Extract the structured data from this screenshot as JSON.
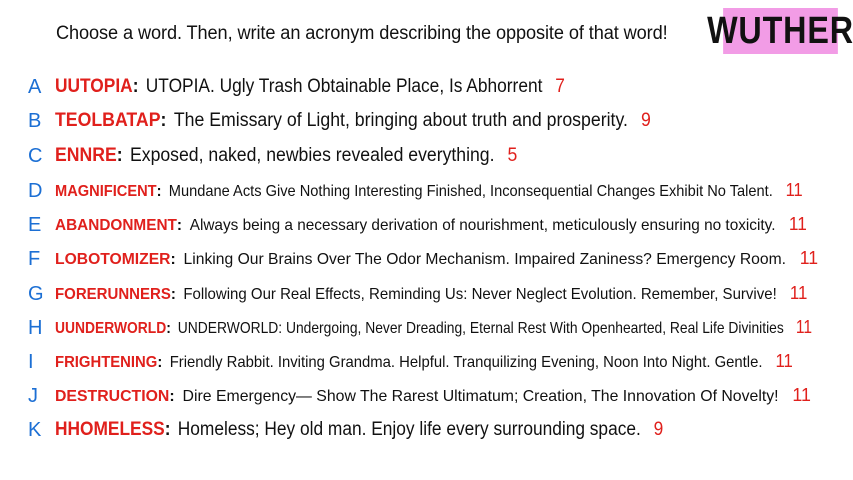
{
  "prompt": "Choose a word. Then, write an acronym describing the opposite of that word!",
  "badge": "WUTHER",
  "colors": {
    "letter": "#1c6fd4",
    "word": "#e0201c",
    "badge_bg": "#f29ce6"
  },
  "entries": [
    {
      "letter": "A",
      "word": "UUTOPIA",
      "text": "UTOPIA. Ugly Trash Obtainable Place, Is Abhorrent",
      "score": "7"
    },
    {
      "letter": "B",
      "word": "TEOLBATAP",
      "text": "The Emissary of Light, bringing about truth and prosperity.",
      "score": "9"
    },
    {
      "letter": "C",
      "word": "ENNRE",
      "text": "Exposed, naked, newbies revealed everything.",
      "score": "5"
    },
    {
      "letter": "D",
      "word": "MAGNIFICENT",
      "text": "Mundane Acts Give Nothing Interesting Finished, Inconsequential Changes Exhibit No Talent.",
      "score": "11"
    },
    {
      "letter": "E",
      "word": "ABANDONMENT",
      "text": "Always being a necessary derivation of nourishment, meticulously ensuring no toxicity.",
      "score": "11"
    },
    {
      "letter": "F",
      "word": "LOBOTOMIZER",
      "text": "Linking Our Brains Over The Odor Mechanism. Impaired Zaniness? Emergency Room.",
      "score": "11"
    },
    {
      "letter": "G",
      "word": "FORERUNNERS",
      "text": "Following Our Real Effects, Reminding Us: Never Neglect Evolution. Remember, Survive!",
      "score": "11"
    },
    {
      "letter": "H",
      "word": "UUNDERWORLD",
      "text": "UNDERWORLD: Undergoing, Never Dreading, Eternal Rest With Openhearted, Real Life Divinities",
      "score": "11"
    },
    {
      "letter": "I",
      "word": "FRIGHTENING",
      "text": "Friendly Rabbit. Inviting Grandma. Helpful. Tranquilizing Evening, Noon Into Night. Gentle.",
      "score": "11"
    },
    {
      "letter": "J",
      "word": "DESTRUCTION",
      "text": "Dire Emergency— Show The Rarest Ultimatum; Creation, The Innovation Of Novelty!",
      "score": "11"
    },
    {
      "letter": "K",
      "word": "HHOMELESS",
      "text": "Homeless; Hey old man. Enjoy life every surrounding space.",
      "score": "9"
    }
  ]
}
